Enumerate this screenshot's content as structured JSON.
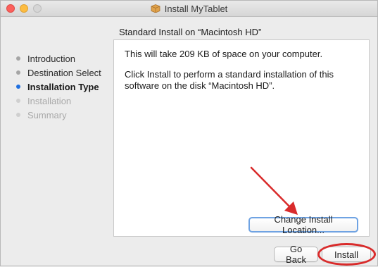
{
  "window": {
    "title": "Install MyTablet",
    "title_icon": "package-icon"
  },
  "header": {
    "subtitle": "Standard Install on “Macintosh HD”"
  },
  "sidebar": {
    "steps": [
      {
        "label": "Introduction",
        "state": "done"
      },
      {
        "label": "Destination Select",
        "state": "done"
      },
      {
        "label": "Installation Type",
        "state": "current"
      },
      {
        "label": "Installation",
        "state": "pending"
      },
      {
        "label": "Summary",
        "state": "pending"
      }
    ]
  },
  "main": {
    "space_text": "This will take 209 KB of space on your computer.",
    "instructions": "Click Install to perform a standard installation of this software on the disk “Macintosh HD”."
  },
  "buttons": {
    "change_location": "Change Install Location...",
    "go_back": "Go Back",
    "install": "Install"
  },
  "colors": {
    "accent": "#1f6fe0",
    "annotation": "#d92b2b",
    "close": "#fc605c",
    "minimize": "#fdbc40"
  }
}
